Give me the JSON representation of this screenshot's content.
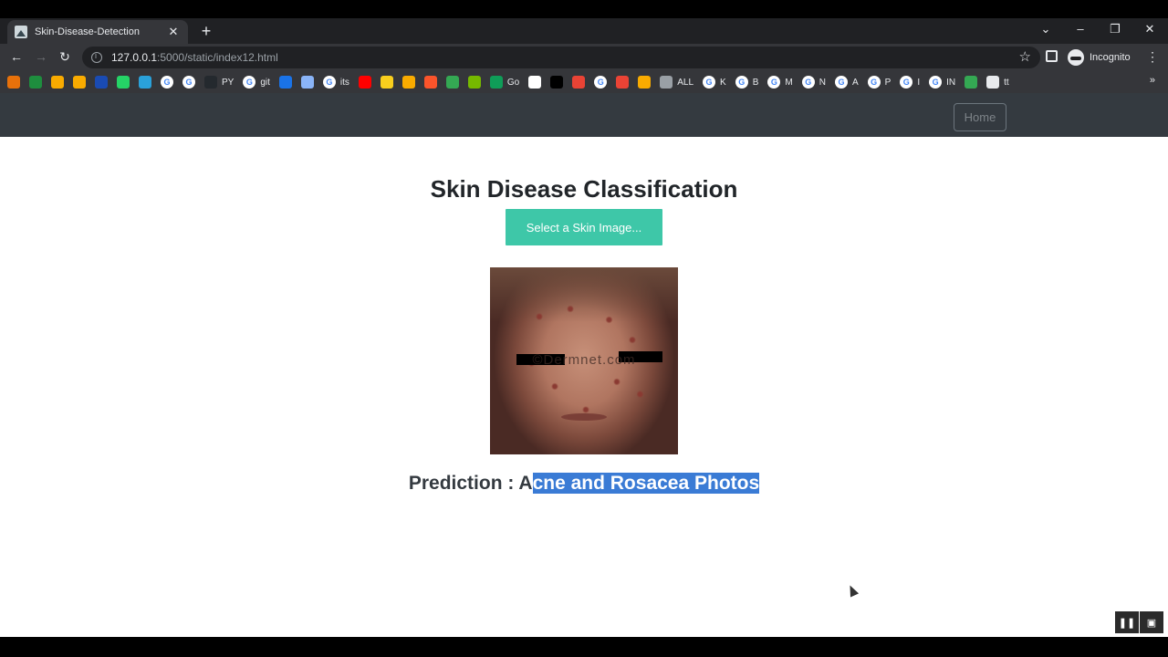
{
  "browser": {
    "tab_title": "Skin-Disease-Detection",
    "url_host": "127.0.0.1",
    "url_rest": ":5000/static/index12.html",
    "profile_label": "Incognito",
    "bookmarks": [
      {
        "icon": "orange-bookmark-icon",
        "label": "",
        "color": "#e8710a"
      },
      {
        "icon": "plus-square-icon",
        "label": "",
        "color": "#1e8e3e"
      },
      {
        "icon": "folder-orange-icon",
        "label": "",
        "color": "#f9ab00"
      },
      {
        "icon": "bar-chart-icon",
        "label": "",
        "color": "#f9ab00"
      },
      {
        "icon": "ieee-icon",
        "label": "",
        "color": "#1a4bb3"
      },
      {
        "icon": "whatsapp-icon",
        "label": "",
        "color": "#25d366"
      },
      {
        "icon": "telegram-icon",
        "label": "",
        "color": "#2aa1da"
      },
      {
        "icon": "google-icon",
        "label": "",
        "color": "#ffffff"
      },
      {
        "icon": "google-icon",
        "label": "",
        "color": "#ffffff"
      },
      {
        "icon": "github-icon",
        "label": "PY",
        "color": "#24292e"
      },
      {
        "icon": "google-icon",
        "label": "git",
        "color": "#ffffff"
      },
      {
        "icon": "doc-icon",
        "label": "",
        "color": "#1a73e8"
      },
      {
        "icon": "car-icon",
        "label": "",
        "color": "#8ab4f8"
      },
      {
        "icon": "google-icon",
        "label": "its",
        "color": "#ffffff"
      },
      {
        "icon": "youtube-icon",
        "label": "",
        "color": "#ff0000"
      },
      {
        "icon": "p-icon",
        "label": "",
        "color": "#f9ce1d"
      },
      {
        "icon": "puzzle-icon",
        "label": "",
        "color": "#f9ab00"
      },
      {
        "icon": "brave-icon",
        "label": "",
        "color": "#fb542b"
      },
      {
        "icon": "green-circle-icon",
        "label": "",
        "color": "#34a853"
      },
      {
        "icon": "nvidia-icon",
        "label": "",
        "color": "#76b900"
      },
      {
        "icon": "edge-icon",
        "label": "Go",
        "color": "#0f9d58"
      },
      {
        "icon": "page-icon",
        "label": "",
        "color": "#ffffff"
      },
      {
        "icon": "cl-icon",
        "label": "",
        "color": "#000000"
      },
      {
        "icon": "red-badge-icon",
        "label": "",
        "color": "#ea4335"
      },
      {
        "icon": "google-icon",
        "label": "",
        "color": "#ffffff"
      },
      {
        "icon": "plane-icon",
        "label": "",
        "color": "#ea4335"
      },
      {
        "icon": "tag-icon",
        "label": "",
        "color": "#f9ab00"
      },
      {
        "icon": "globe-icon",
        "label": "ALL",
        "color": "#9aa0a6"
      },
      {
        "icon": "google-icon",
        "label": "K",
        "color": "#ffffff"
      },
      {
        "icon": "google-icon",
        "label": "B",
        "color": "#ffffff"
      },
      {
        "icon": "google-icon",
        "label": "M",
        "color": "#ffffff"
      },
      {
        "icon": "google-icon",
        "label": "N",
        "color": "#ffffff"
      },
      {
        "icon": "google-icon",
        "label": "A",
        "color": "#ffffff"
      },
      {
        "icon": "google-icon",
        "label": "P",
        "color": "#ffffff"
      },
      {
        "icon": "google-icon",
        "label": "I",
        "color": "#ffffff"
      },
      {
        "icon": "google-icon",
        "label": "IN",
        "color": "#ffffff"
      },
      {
        "icon": "speaker-icon",
        "label": "",
        "color": "#34a853"
      },
      {
        "icon": "monitor-icon",
        "label": "tt",
        "color": "#e8eaed"
      }
    ],
    "bookmarks_more": "»"
  },
  "page": {
    "nav_home": "Home",
    "title": "Skin Disease Classification",
    "select_button": "Select a Skin Image...",
    "preview_watermark": "©Dermnet.com",
    "prediction_prefix": "Prediction : A",
    "prediction_selected": "cne and Rosacea Photos"
  },
  "colors": {
    "navbar": "#343a40",
    "accent_button": "#3ec7a8",
    "selection": "#3a7bd5"
  }
}
